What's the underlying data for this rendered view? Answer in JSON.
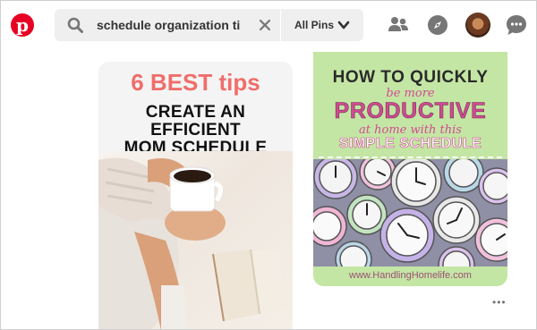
{
  "header": {
    "logo_letter": "p",
    "search": {
      "value": "schedule organization ti"
    },
    "filter_label": "All Pins"
  },
  "icons": {
    "logo": "pinterest-logo",
    "search": "search-icon",
    "clear": "close-icon",
    "filter": "chevron-down-icon",
    "people": "people-icon",
    "explore": "compass-icon",
    "profile": "avatar",
    "messages": "chat-icon"
  },
  "colors": {
    "brand": "#e60023",
    "pin_left_accent": "#ef6e6b",
    "pin_right_bg": "#c4e6a4",
    "pin_right_accent": "#d24b93"
  },
  "pins": [
    {
      "title": "6 BEST tips",
      "lines": [
        "CREATE AN",
        "EFFICIENT",
        "MOM SCHEDULE"
      ]
    },
    {
      "line1": "HOW TO QUICKLY",
      "line2": "be more",
      "line3": "PRODUCTIVE",
      "line4": "at home with this",
      "line5": "SIMPLE SCHEDULE",
      "url": "www.HandlingHomelife.com"
    }
  ],
  "more_label": "•••"
}
